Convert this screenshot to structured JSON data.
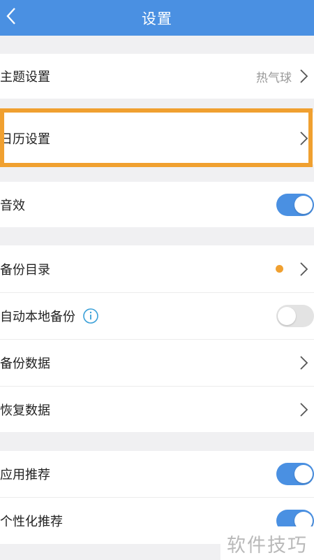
{
  "header": {
    "title": "设置",
    "back_icon": "chevron-left-icon"
  },
  "rows": {
    "theme": {
      "label": "主题设置",
      "value": "热气球"
    },
    "calendar": {
      "label": "日历设置"
    },
    "sound": {
      "label": "音效",
      "toggle": "on"
    },
    "backup_dir": {
      "label": "备份目录",
      "badge_color": "#f0a030"
    },
    "auto_backup": {
      "label": "自动本地备份",
      "toggle": "off",
      "icon": "info-icon"
    },
    "backup_data": {
      "label": "备份数据"
    },
    "restore_data": {
      "label": "恢复数据"
    },
    "app_recommend": {
      "label": "应用推荐",
      "toggle": "on"
    },
    "personal_recommend": {
      "label": "个性化推荐",
      "toggle": "on"
    }
  },
  "highlight_color": "#f0a030",
  "accent_color": "#4a90e2",
  "watermark": {
    "text": "软件技巧"
  }
}
